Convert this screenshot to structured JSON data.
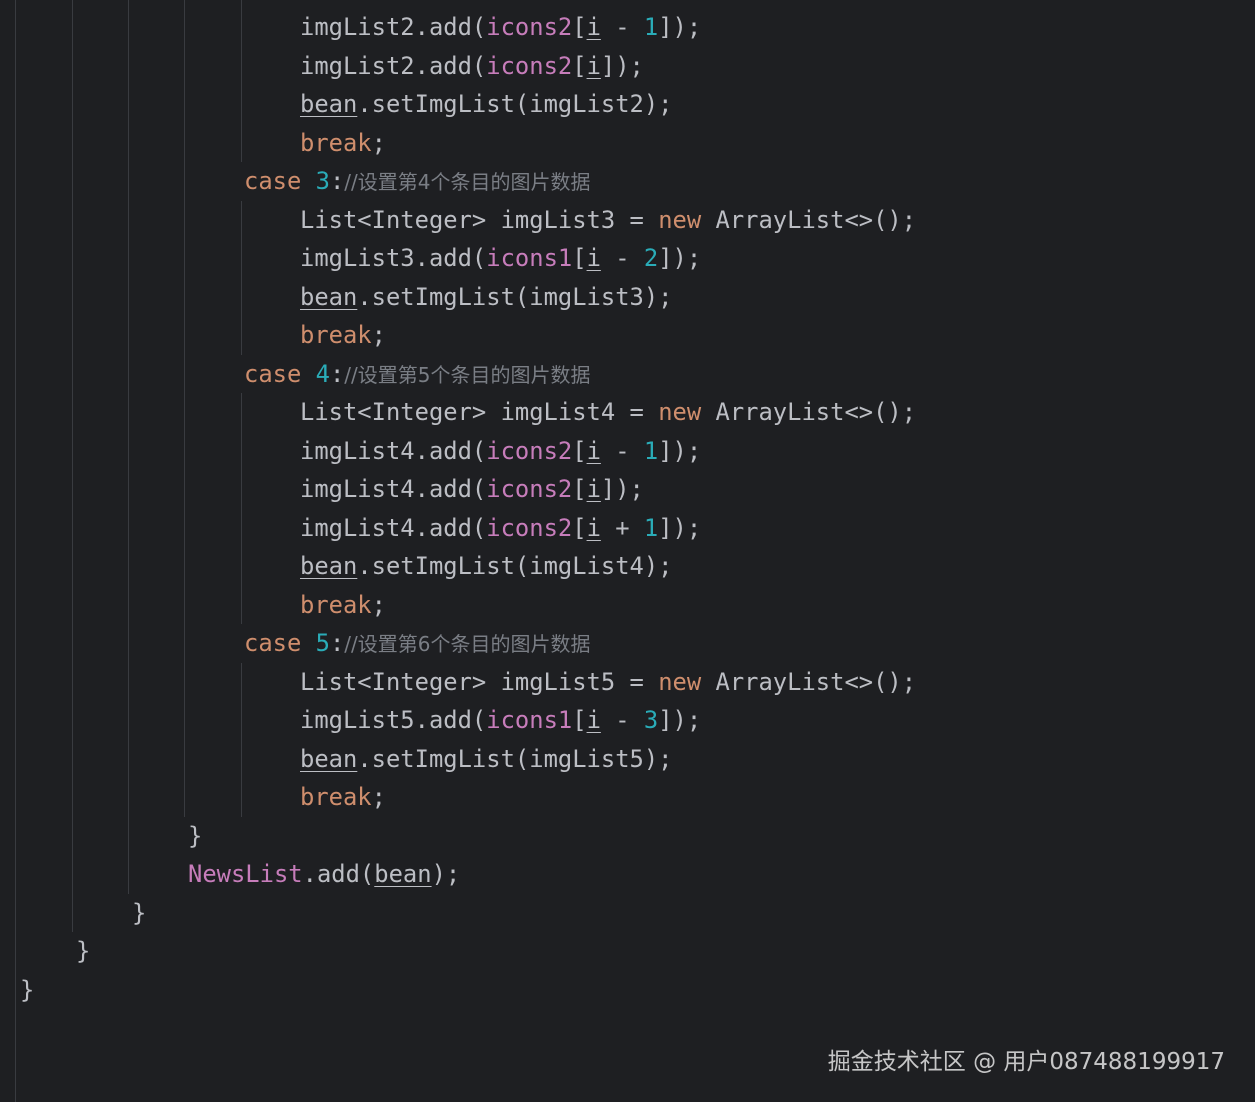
{
  "editor": {
    "theme_colors": {
      "background": "#1e1f22",
      "default_text": "#bcbec4",
      "keyword": "#cf8e6d",
      "number": "#2aacb8",
      "field": "#c77dbb",
      "comment": "#7a7e85",
      "indent_guide": "#393b40"
    },
    "lines": [
      {
        "indent": 5,
        "tokens": [
          {
            "t": "imgList2.add(",
            "c": "plain"
          },
          {
            "t": "icons2",
            "c": "field"
          },
          {
            "t": "[",
            "c": "plain"
          },
          {
            "t": "i",
            "c": "ul"
          },
          {
            "t": " - ",
            "c": "plain"
          },
          {
            "t": "1",
            "c": "num"
          },
          {
            "t": "]);",
            "c": "plain"
          }
        ]
      },
      {
        "indent": 5,
        "tokens": [
          {
            "t": "imgList2.add(",
            "c": "plain"
          },
          {
            "t": "icons2",
            "c": "field"
          },
          {
            "t": "[",
            "c": "plain"
          },
          {
            "t": "i",
            "c": "ul"
          },
          {
            "t": "]);",
            "c": "plain"
          }
        ]
      },
      {
        "indent": 5,
        "tokens": [
          {
            "t": "bean",
            "c": "ul"
          },
          {
            "t": ".setImgList(imgList2);",
            "c": "plain"
          }
        ]
      },
      {
        "indent": 5,
        "tokens": [
          {
            "t": "break",
            "c": "kw"
          },
          {
            "t": ";",
            "c": "plain"
          }
        ]
      },
      {
        "indent": 4,
        "tokens": [
          {
            "t": "case",
            "c": "kw"
          },
          {
            "t": " ",
            "c": "plain"
          },
          {
            "t": "3",
            "c": "num"
          },
          {
            "t": ":",
            "c": "plain"
          },
          {
            "t": "//",
            "c": "comment"
          },
          {
            "t": "设置第4个条目的图片数据",
            "c": "comment"
          }
        ]
      },
      {
        "indent": 5,
        "tokens": [
          {
            "t": "List<Integer> imgList3 = ",
            "c": "plain"
          },
          {
            "t": "new",
            "c": "kw"
          },
          {
            "t": " ArrayList<>();",
            "c": "plain"
          }
        ]
      },
      {
        "indent": 5,
        "tokens": [
          {
            "t": "imgList3.add(",
            "c": "plain"
          },
          {
            "t": "icons1",
            "c": "field"
          },
          {
            "t": "[",
            "c": "plain"
          },
          {
            "t": "i",
            "c": "ul"
          },
          {
            "t": " - ",
            "c": "plain"
          },
          {
            "t": "2",
            "c": "num"
          },
          {
            "t": "]);",
            "c": "plain"
          }
        ]
      },
      {
        "indent": 5,
        "tokens": [
          {
            "t": "bean",
            "c": "ul"
          },
          {
            "t": ".setImgList(imgList3);",
            "c": "plain"
          }
        ]
      },
      {
        "indent": 5,
        "tokens": [
          {
            "t": "break",
            "c": "kw"
          },
          {
            "t": ";",
            "c": "plain"
          }
        ]
      },
      {
        "indent": 4,
        "tokens": [
          {
            "t": "case",
            "c": "kw"
          },
          {
            "t": " ",
            "c": "plain"
          },
          {
            "t": "4",
            "c": "num"
          },
          {
            "t": ":",
            "c": "plain"
          },
          {
            "t": "//",
            "c": "comment"
          },
          {
            "t": "设置第5个条目的图片数据",
            "c": "comment"
          }
        ]
      },
      {
        "indent": 5,
        "tokens": [
          {
            "t": "List<Integer> imgList4 = ",
            "c": "plain"
          },
          {
            "t": "new",
            "c": "kw"
          },
          {
            "t": " ArrayList<>();",
            "c": "plain"
          }
        ]
      },
      {
        "indent": 5,
        "tokens": [
          {
            "t": "imgList4.add(",
            "c": "plain"
          },
          {
            "t": "icons2",
            "c": "field"
          },
          {
            "t": "[",
            "c": "plain"
          },
          {
            "t": "i",
            "c": "ul"
          },
          {
            "t": " - ",
            "c": "plain"
          },
          {
            "t": "1",
            "c": "num"
          },
          {
            "t": "]);",
            "c": "plain"
          }
        ]
      },
      {
        "indent": 5,
        "tokens": [
          {
            "t": "imgList4.add(",
            "c": "plain"
          },
          {
            "t": "icons2",
            "c": "field"
          },
          {
            "t": "[",
            "c": "plain"
          },
          {
            "t": "i",
            "c": "ul"
          },
          {
            "t": "]);",
            "c": "plain"
          }
        ]
      },
      {
        "indent": 5,
        "tokens": [
          {
            "t": "imgList4.add(",
            "c": "plain"
          },
          {
            "t": "icons2",
            "c": "field"
          },
          {
            "t": "[",
            "c": "plain"
          },
          {
            "t": "i",
            "c": "ul"
          },
          {
            "t": " + ",
            "c": "plain"
          },
          {
            "t": "1",
            "c": "num"
          },
          {
            "t": "]);",
            "c": "plain"
          }
        ]
      },
      {
        "indent": 5,
        "tokens": [
          {
            "t": "bean",
            "c": "ul"
          },
          {
            "t": ".setImgList(imgList4);",
            "c": "plain"
          }
        ]
      },
      {
        "indent": 5,
        "tokens": [
          {
            "t": "break",
            "c": "kw"
          },
          {
            "t": ";",
            "c": "plain"
          }
        ]
      },
      {
        "indent": 4,
        "tokens": [
          {
            "t": "case",
            "c": "kw"
          },
          {
            "t": " ",
            "c": "plain"
          },
          {
            "t": "5",
            "c": "num"
          },
          {
            "t": ":",
            "c": "plain"
          },
          {
            "t": "//",
            "c": "comment"
          },
          {
            "t": "设置第6个条目的图片数据",
            "c": "comment"
          }
        ]
      },
      {
        "indent": 5,
        "tokens": [
          {
            "t": "List<Integer> imgList5 = ",
            "c": "plain"
          },
          {
            "t": "new",
            "c": "kw"
          },
          {
            "t": " ArrayList<>();",
            "c": "plain"
          }
        ]
      },
      {
        "indent": 5,
        "tokens": [
          {
            "t": "imgList5.add(",
            "c": "plain"
          },
          {
            "t": "icons1",
            "c": "field"
          },
          {
            "t": "[",
            "c": "plain"
          },
          {
            "t": "i",
            "c": "ul"
          },
          {
            "t": " - ",
            "c": "plain"
          },
          {
            "t": "3",
            "c": "num"
          },
          {
            "t": "]);",
            "c": "plain"
          }
        ]
      },
      {
        "indent": 5,
        "tokens": [
          {
            "t": "bean",
            "c": "ul"
          },
          {
            "t": ".setImgList(imgList5);",
            "c": "plain"
          }
        ]
      },
      {
        "indent": 5,
        "tokens": [
          {
            "t": "break",
            "c": "kw"
          },
          {
            "t": ";",
            "c": "plain"
          }
        ]
      },
      {
        "indent": 3,
        "tokens": [
          {
            "t": "}",
            "c": "plain"
          }
        ]
      },
      {
        "indent": 3,
        "tokens": [
          {
            "t": "NewsList",
            "c": "field"
          },
          {
            "t": ".add(",
            "c": "plain"
          },
          {
            "t": "bean",
            "c": "ul"
          },
          {
            "t": ");",
            "c": "plain"
          }
        ]
      },
      {
        "indent": 2,
        "tokens": [
          {
            "t": "}",
            "c": "plain"
          }
        ]
      },
      {
        "indent": 1,
        "tokens": [
          {
            "t": "}",
            "c": "plain"
          }
        ]
      },
      {
        "indent": 0,
        "tokens": [
          {
            "t": "}",
            "c": "plain"
          }
        ]
      }
    ]
  },
  "watermark": {
    "text": "掘金技术社区 @ 用户087488199917"
  }
}
